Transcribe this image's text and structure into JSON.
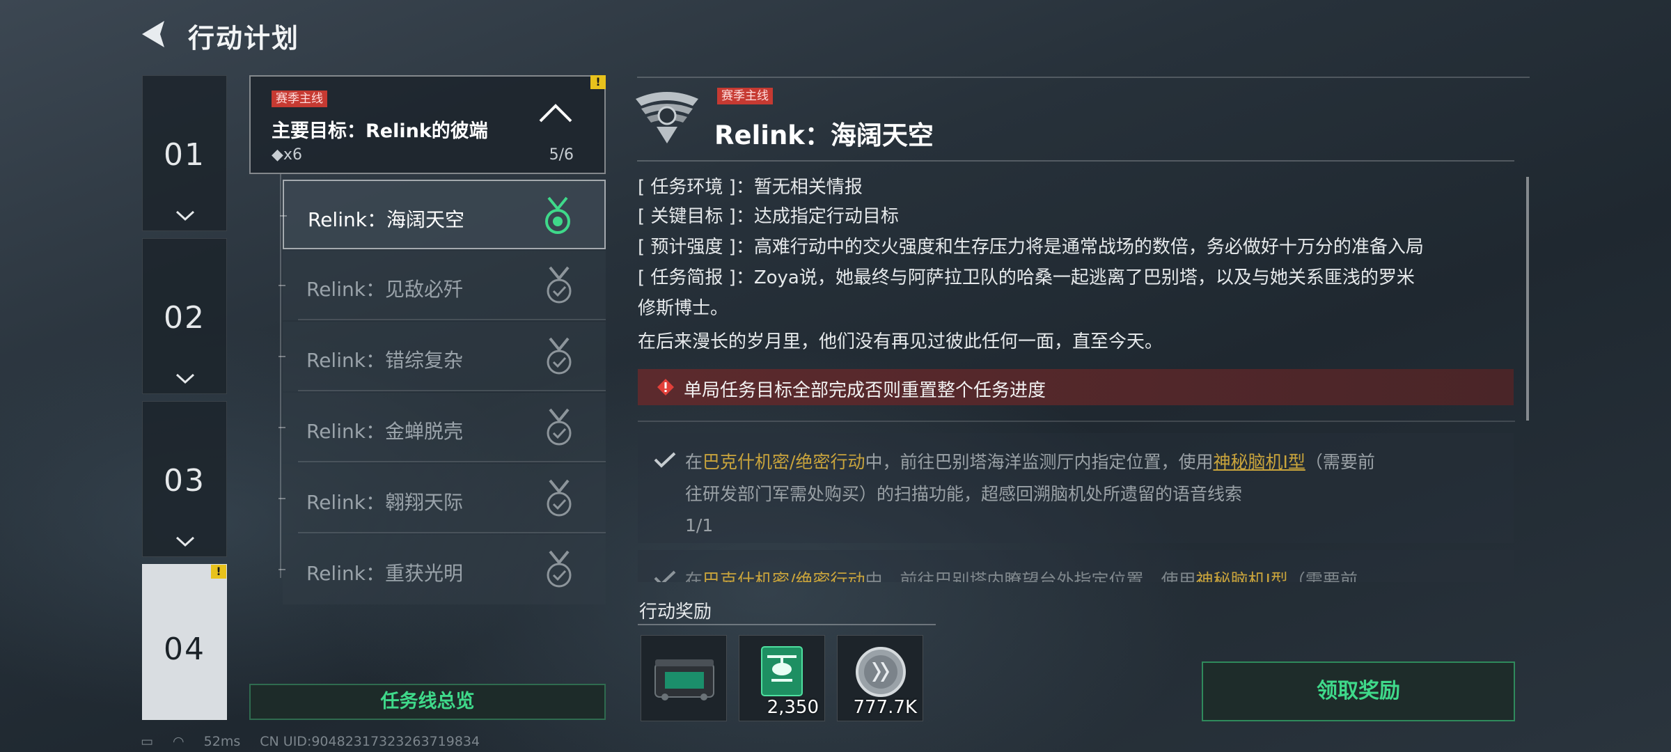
{
  "header": {
    "title": "行动计划"
  },
  "chapters": [
    {
      "label": "01",
      "alert": ""
    },
    {
      "label": "02",
      "alert": ""
    },
    {
      "label": "03",
      "alert": ""
    },
    {
      "label": "04",
      "alert": "!"
    }
  ],
  "main_objective": {
    "tag": "赛季主线",
    "title": "主要目标：Relink的彼端",
    "reward_count": "◆x6",
    "progress": "5/6",
    "alert": "!"
  },
  "missions": [
    {
      "label": "Relink：海阔天空",
      "state": "active"
    },
    {
      "label": "Relink：见敌必歼",
      "state": "done"
    },
    {
      "label": "Relink：错综复杂",
      "state": "done"
    },
    {
      "label": "Relink：金蝉脱壳",
      "state": "done"
    },
    {
      "label": "Relink：翱翔天际",
      "state": "done"
    },
    {
      "label": "Relink：重获光明",
      "state": "done"
    }
  ],
  "overview_button": "任务线总览",
  "detail": {
    "tag": "赛季主线",
    "title": "Relink：海阔天空",
    "environment_key": "[ 任务环境 ]：",
    "environment_val": "暂无相关情报",
    "target_key": "[ 关键目标 ]：",
    "target_val": "达成指定行动目标",
    "intensity_key": "[ 预计强度 ]：",
    "intensity_val": "高难行动中的交火强度和生存压力将是通常战场的数倍，务必做好十万分的准备入局",
    "brief_key": "[ 任务简报 ]：",
    "brief_val_1": "Zoya说，她最终与阿萨拉卫队的哈桑一起逃离了巴别塔，以及与她关系匪浅的罗米",
    "brief_val_2": "修斯博士。",
    "brief_val_3": "在后来漫长的岁月里，他们没有再见过彼此任何一面，直至今天。",
    "warning": "单局任务目标全部完成否则重置整个任务进度"
  },
  "tasks": [
    {
      "pre": "在",
      "map": "巴克什机密/绝密行动",
      "mid": "中，前往巴别塔海洋监测厅内指定位置，使用",
      "item": "神秘脑机Ⅰ型",
      "post": "（需要前",
      "line2": "往研发部门军需处购买）的扫描功能，超感回溯脑机处所遗留的语音线索",
      "count": "1/1"
    },
    {
      "pre": "在",
      "map": "巴克什机密/绝密行动",
      "mid": "中，前往巴别塔内瞭望台外指定位置，使用",
      "item": "神秘脑机Ⅰ型",
      "post": "（需要前"
    }
  ],
  "rewards": {
    "label": "行动奖励",
    "items": [
      {
        "icon": "supply-case-icon",
        "qty": ""
      },
      {
        "icon": "helicopter-emblem-icon",
        "qty": "2,350"
      },
      {
        "icon": "silver-coin-icon",
        "qty": "777.7K"
      }
    ]
  },
  "claim_button": "领取奖励",
  "status_bar": {
    "ping": "52ms",
    "uid": "CN UID:9048231732326371983​4"
  },
  "colors": {
    "accent_green": "#3fd98a",
    "tag_red": "#c63a32",
    "highlight_gold": "#c9a43c",
    "warning_bg": "#5c2a2d"
  }
}
